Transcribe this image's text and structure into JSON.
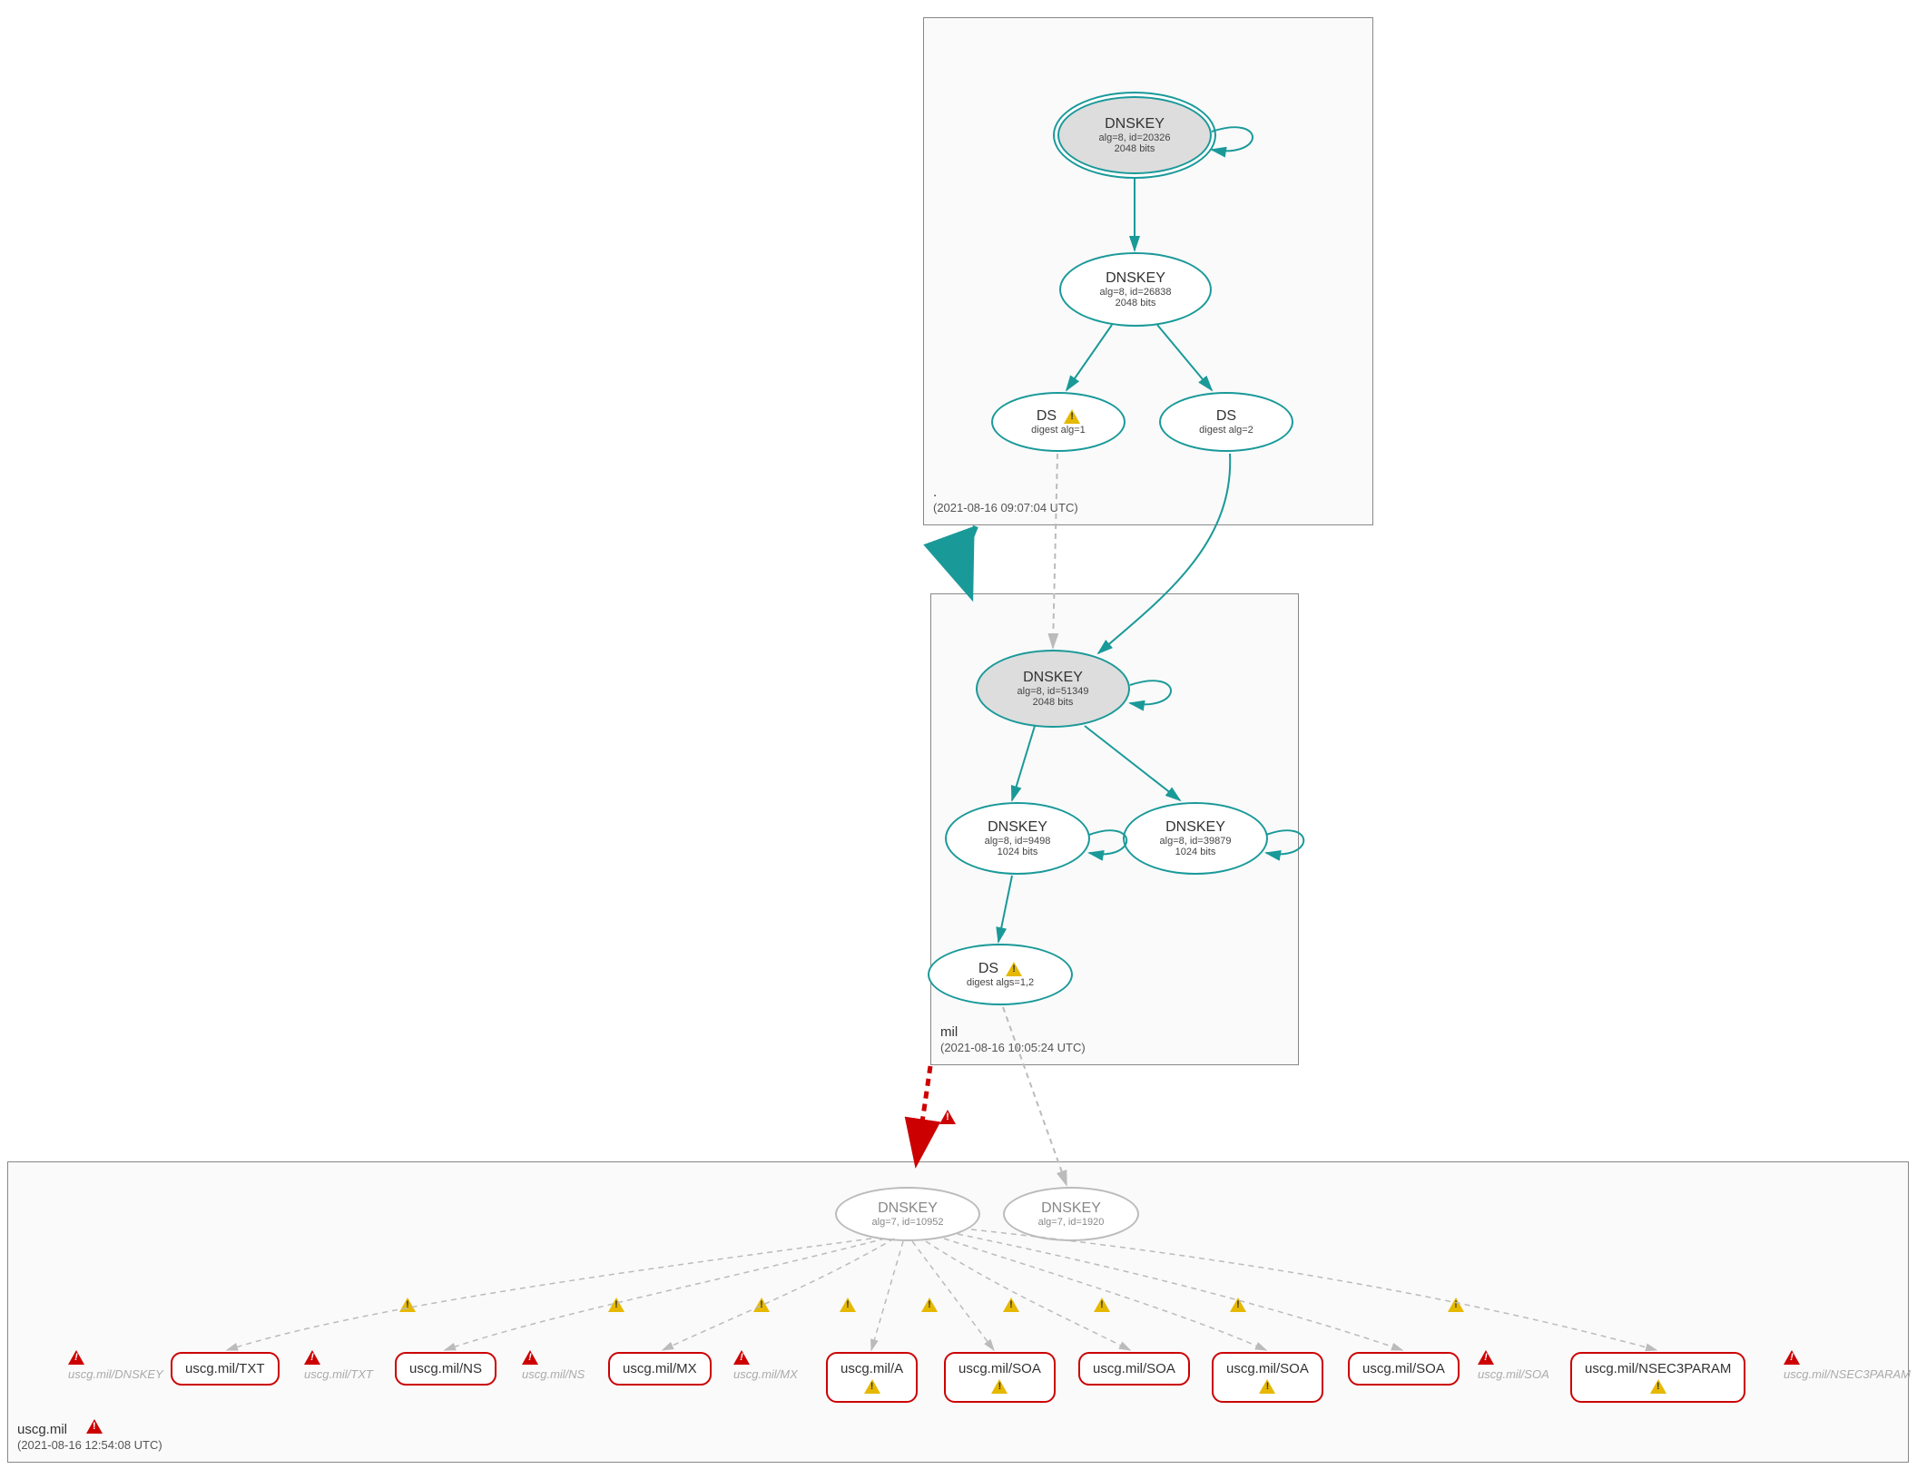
{
  "zones": {
    "root": {
      "name": ".",
      "timestamp": "(2021-08-16 09:07:04 UTC)"
    },
    "mil": {
      "name": "mil",
      "timestamp": "(2021-08-16 10:05:24 UTC)"
    },
    "uscg": {
      "name": "uscg.mil",
      "timestamp": "(2021-08-16 12:54:08 UTC)"
    }
  },
  "nodes": {
    "root_ksk": {
      "title": "DNSKEY",
      "line1": "alg=8, id=20326",
      "line2": "2048 bits"
    },
    "root_zsk": {
      "title": "DNSKEY",
      "line1": "alg=8, id=26838",
      "line2": "2048 bits"
    },
    "root_ds1": {
      "title": "DS",
      "line1": "digest alg=1"
    },
    "root_ds2": {
      "title": "DS",
      "line1": "digest alg=2"
    },
    "mil_ksk": {
      "title": "DNSKEY",
      "line1": "alg=8, id=51349",
      "line2": "2048 bits"
    },
    "mil_zsk1": {
      "title": "DNSKEY",
      "line1": "alg=8, id=9498",
      "line2": "1024 bits"
    },
    "mil_zsk2": {
      "title": "DNSKEY",
      "line1": "alg=8, id=39879",
      "line2": "1024 bits"
    },
    "mil_ds": {
      "title": "DS",
      "line1": "digest algs=1,2"
    },
    "uscg_key1": {
      "title": "DNSKEY",
      "line1": "alg=7, id=10952"
    },
    "uscg_key2": {
      "title": "DNSKEY",
      "line1": "alg=7, id=1920"
    }
  },
  "rr_boxes": {
    "txt": "uscg.mil/TXT",
    "ns": "uscg.mil/NS",
    "mx": "uscg.mil/MX",
    "a": "uscg.mil/A",
    "soa1": "uscg.mil/SOA",
    "soa2": "uscg.mil/SOA",
    "soa3": "uscg.mil/SOA",
    "soa4": "uscg.mil/SOA",
    "nsec3": "uscg.mil/NSEC3PARAM"
  },
  "rr_labels": {
    "dnskey": "uscg.mil/DNSKEY",
    "txt": "uscg.mil/TXT",
    "ns": "uscg.mil/NS",
    "mx": "uscg.mil/MX",
    "soa": "uscg.mil/SOA",
    "nsec3": "uscg.mil/NSEC3PARAM"
  }
}
